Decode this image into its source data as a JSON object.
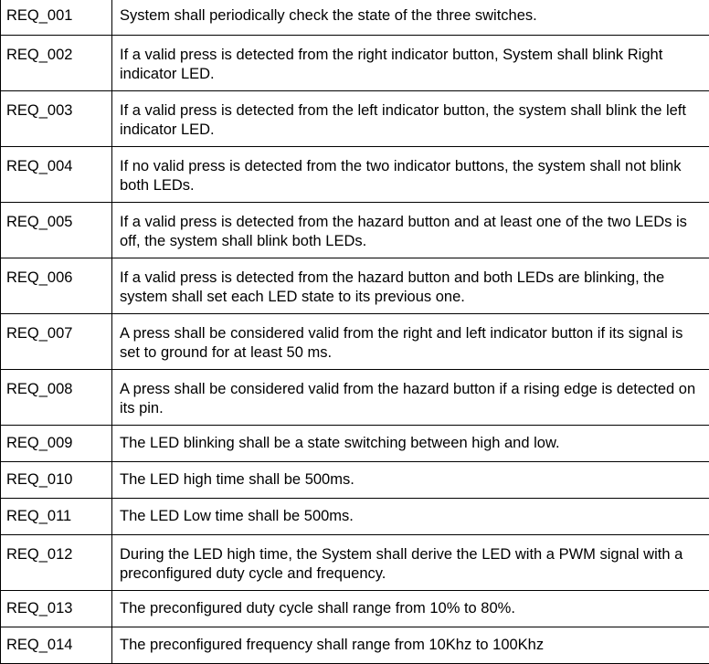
{
  "requirements": [
    {
      "id": "REQ_001",
      "text": "System shall periodically check the state of the three switches.",
      "lines": 1
    },
    {
      "id": "REQ_002",
      "text": "If a valid press is detected from the right indicator button, System shall blink Right indicator LED.",
      "lines": 2
    },
    {
      "id": "REQ_003",
      "text": "If a valid press is detected from the left indicator button, the system shall blink the left indicator LED.",
      "lines": 2
    },
    {
      "id": "REQ_004",
      "text": "If no valid press is detected from the two indicator buttons, the system shall not blink both LEDs.",
      "lines": 2
    },
    {
      "id": "REQ_005",
      "text": "If a valid press is detected from the hazard button and at least one of the two LEDs is off, the system shall blink both LEDs.",
      "lines": 2
    },
    {
      "id": "REQ_006",
      "text": "If a valid press is detected from the hazard button and both LEDs are blinking, the system shall set each LED state to its previous one.",
      "lines": 2
    },
    {
      "id": "REQ_007",
      "text": "A press shall be considered valid from the right and left indicator button if its signal is set to ground for at least 50 ms.",
      "lines": 2
    },
    {
      "id": "REQ_008",
      "text": "A press shall be considered valid from the hazard button if a rising edge is detected on its pin.",
      "lines": 2
    },
    {
      "id": "REQ_009",
      "text": "The LED blinking shall be a state switching between high and low.",
      "lines": 1
    },
    {
      "id": "REQ_010",
      "text": "The LED high time shall be 500ms.",
      "lines": 1
    },
    {
      "id": "REQ_011",
      "text": "The LED Low time shall be 500ms.",
      "lines": 1
    },
    {
      "id": "REQ_012",
      "text": "During the LED high time, the System shall derive the LED with a PWM signal with a preconfigured duty cycle and  frequency.",
      "lines": 2
    },
    {
      "id": "REQ_013",
      "text": "The preconfigured duty cycle shall range from 10% to 80%.",
      "lines": 1
    },
    {
      "id": "REQ_014",
      "text": "The preconfigured frequency shall range from 10Khz to 100Khz",
      "lines": 1
    }
  ]
}
